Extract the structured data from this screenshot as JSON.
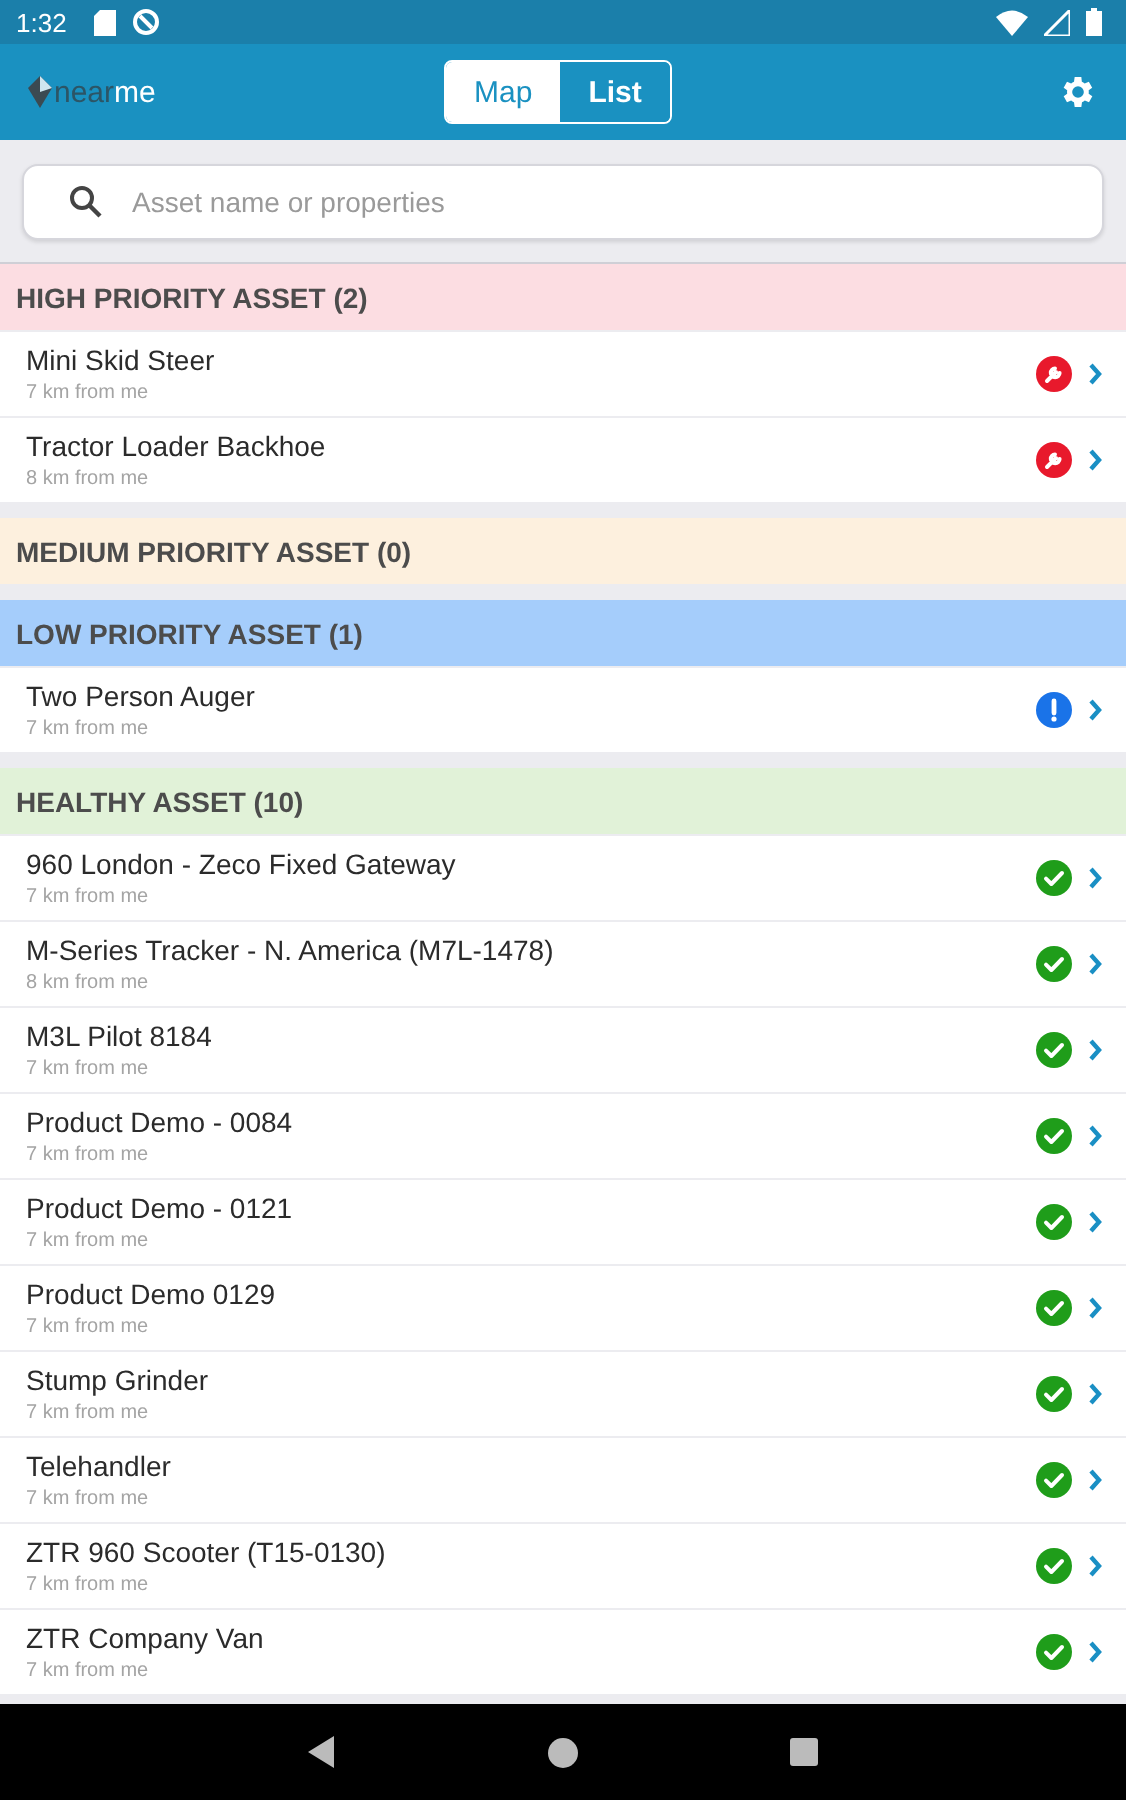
{
  "status_bar": {
    "time": "1:32"
  },
  "app_bar": {
    "logo": {
      "part_1": "near",
      "part_2": "me"
    },
    "tabs": [
      {
        "label": "Map",
        "selected": false
      },
      {
        "label": "List",
        "selected": true
      }
    ]
  },
  "search": {
    "placeholder": "Asset name or properties"
  },
  "sections": [
    {
      "title": "HIGH PRIORITY ASSET (2)",
      "color": "#fcdde2",
      "items": [
        {
          "name": "Mini Skid Steer",
          "distance": "7 km from me",
          "kind": "wrench"
        },
        {
          "name": "Tractor Loader Backhoe",
          "distance": "8 km from me",
          "kind": "wrench"
        }
      ]
    },
    {
      "title": "MEDIUM PRIORITY ASSET (0)",
      "color": "#fdf0de"
    },
    {
      "title": "LOW PRIORITY ASSET (1)",
      "color": "#a5cdfb",
      "items": [
        {
          "name": "Two Person Auger",
          "distance": "7 km from me",
          "kind": "alert"
        }
      ]
    },
    {
      "title": "HEALTHY ASSET (10)",
      "color": "#e1f2d8",
      "items": [
        {
          "name": "960 London - Zeco Fixed Gateway",
          "distance": "7 km from me",
          "kind": "check"
        },
        {
          "name": "M-Series Tracker - N. America (M7L-1478)",
          "distance": "8 km from me",
          "kind": "check"
        },
        {
          "name": "M3L Pilot 8184",
          "distance": "7 km from me",
          "kind": "check"
        },
        {
          "name": "Product Demo - 0084",
          "distance": "7 km from me",
          "kind": "check"
        },
        {
          "name": "Product Demo - 0121",
          "distance": "7 km from me",
          "kind": "check"
        },
        {
          "name": "Product Demo 0129",
          "distance": "7 km from me",
          "kind": "check"
        },
        {
          "name": "Stump Grinder",
          "distance": "7 km from me",
          "kind": "check"
        },
        {
          "name": "Telehandler",
          "distance": "7 km from me",
          "kind": "check"
        },
        {
          "name": "ZTR 960 Scooter (T15-0130)",
          "distance": "7 km from me",
          "kind": "check"
        },
        {
          "name": "ZTR Company Van",
          "distance": "7 km from me",
          "kind": "check"
        }
      ]
    }
  ]
}
